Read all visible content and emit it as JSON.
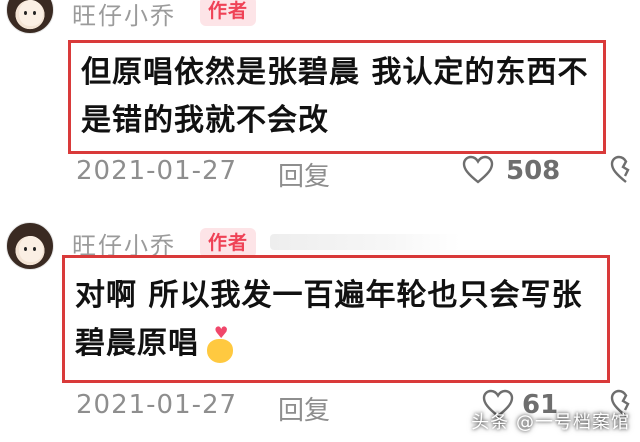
{
  "comments": [
    {
      "username": "旺仔小乔",
      "badge": "作者",
      "text_line1": "但原唱依然是张碧晨 我认定的东西不",
      "text_line2": "是错的我就不会改",
      "date": "2021-01-27",
      "reply": "回复",
      "likes": "508"
    },
    {
      "username": "旺仔小乔",
      "badge": "作者",
      "text_line1": "对啊 所以我发一百遍年轮也只会写张",
      "text_line2": "碧晨原唱",
      "emoji": "finger-heart-emoji",
      "date": "2021-01-27",
      "reply": "回复",
      "likes": "61"
    }
  ],
  "watermark": {
    "text": "头条 @一号档案馆"
  },
  "colors": {
    "highlight_box": "#d93a3a",
    "badge_text": "#ef4256",
    "badge_bg": "#fde4e7",
    "meta_text": "#8e8e8e"
  }
}
